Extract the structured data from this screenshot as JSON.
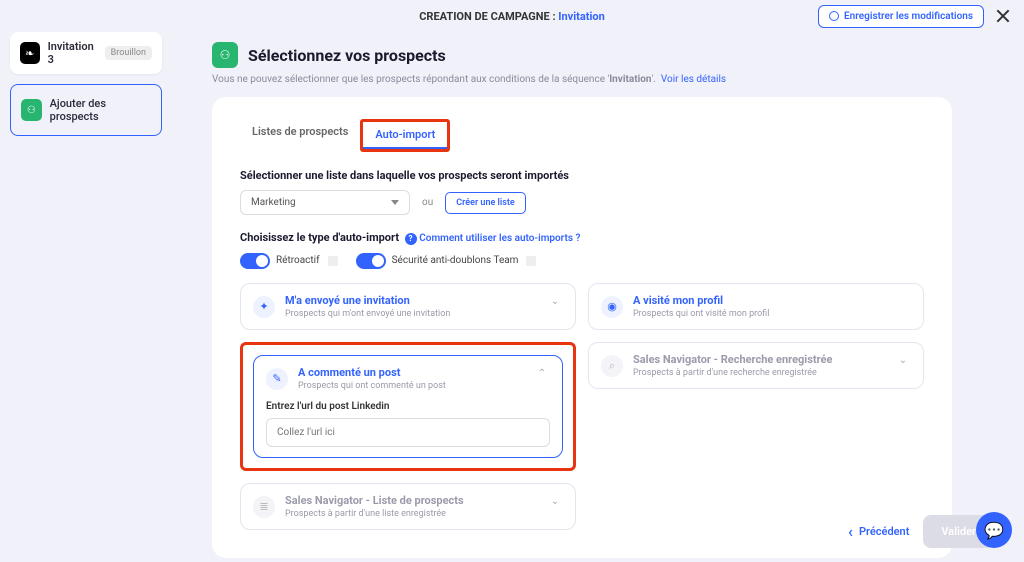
{
  "topbar": {
    "creation_label": "CREATION DE CAMPAGNE :",
    "creation_link": "Invitation",
    "save_button": "Enregistrer les modifications"
  },
  "sidebar": {
    "campaign_name": "Invitation 3",
    "draft_badge": "Brouillon",
    "step_label": "Ajouter des prospects"
  },
  "page": {
    "title": "Sélectionnez vos prospects",
    "subtitle_prefix": "Vous ne pouvez sélectionner que les prospects répondant aux conditions de la séquence '",
    "subtitle_seq": "Invitation",
    "subtitle_suffix": "'.",
    "details_link": "Voir les détails"
  },
  "tabs": {
    "lists": "Listes de prospects",
    "auto_import": "Auto-import"
  },
  "list_section": {
    "label": "Sélectionner une liste dans laquelle vos prospects seront importés",
    "selected": "Marketing",
    "or": "ou",
    "create_button": "Créer une liste"
  },
  "autoimport_section": {
    "label": "Choisissez le type d'auto-import",
    "help_link": "Comment utiliser les auto-imports ?",
    "toggle_retro": "Rétroactif",
    "toggle_antidup": "Sécurité anti-doublons Team"
  },
  "options": {
    "sent_invite": {
      "title": "M'a envoyé une invitation",
      "desc": "Prospects qui m'ont envoyé une invitation"
    },
    "visited": {
      "title": "A visité mon profil",
      "desc": "Prospects qui ont visité mon profil"
    },
    "commented": {
      "title": "A commenté un post",
      "desc": "Prospects qui ont commenté un post",
      "input_label": "Entrez l'url du post Linkedin",
      "placeholder": "Collez l'url ici"
    },
    "sn_search": {
      "title": "Sales Navigator - Recherche enregistrée",
      "desc": "Prospects à partir d'une recherche enregistrée"
    },
    "sn_list": {
      "title": "Sales Navigator - Liste de prospects",
      "desc": "Prospects à partir d'une liste enregistrée"
    }
  },
  "footer": {
    "prev": "Précédent",
    "validate": "Valider"
  }
}
